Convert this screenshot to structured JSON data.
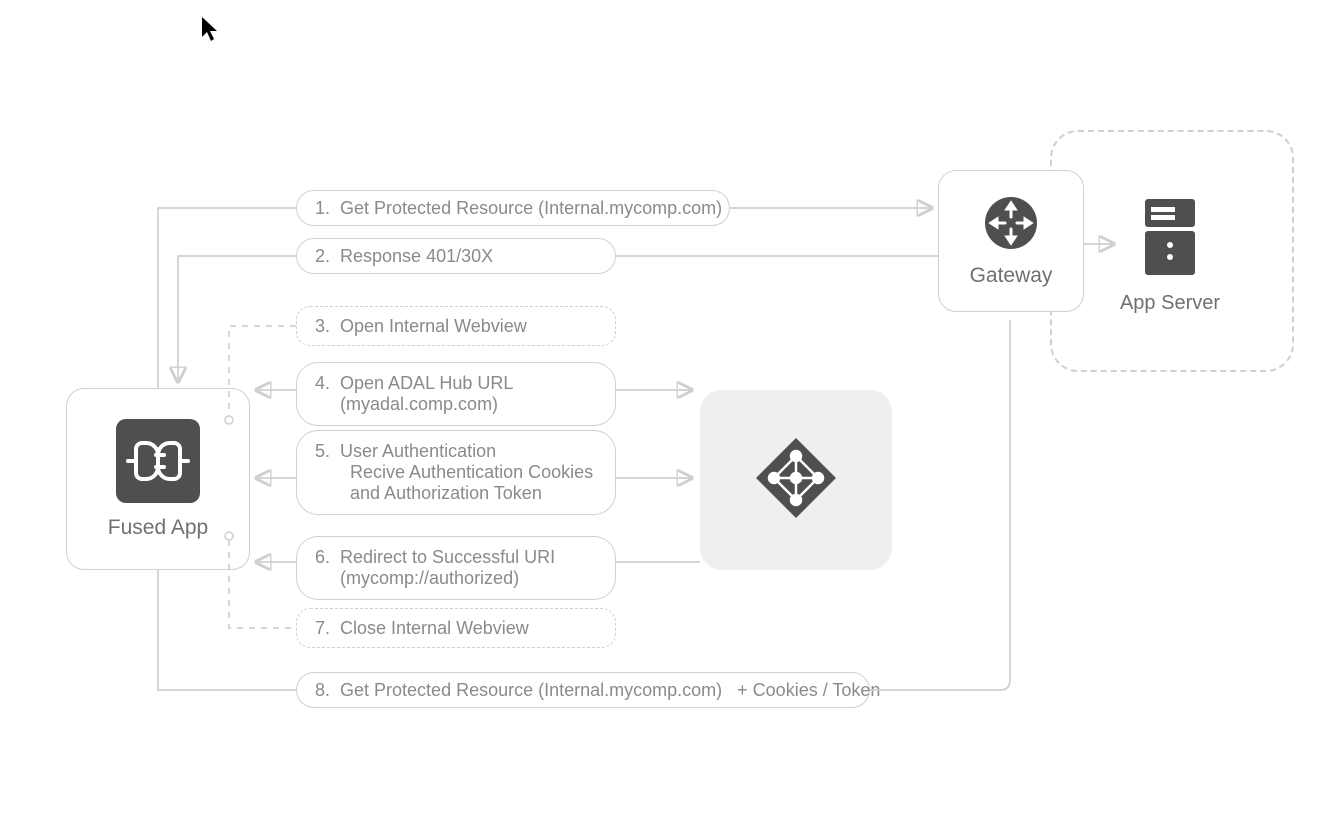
{
  "nodes": {
    "fused_app": {
      "label": "Fused App"
    },
    "gateway": {
      "label": "Gateway"
    },
    "app_server": {
      "label": "App Server"
    },
    "adal": {
      "label": ""
    }
  },
  "steps": {
    "s1": {
      "num": "1.",
      "text": "Get Protected Resource (Internal.mycomp.com)"
    },
    "s2": {
      "num": "2.",
      "text": "Response 401/30X"
    },
    "s3": {
      "num": "3.",
      "text": "Open Internal Webview"
    },
    "s4": {
      "num": "4.",
      "text": "Open ADAL Hub URL\n(myadal.comp.com)"
    },
    "s5": {
      "num": "5.",
      "text": "User Authentication\n  Recive Authentication Cookies\n  and Authorization Token"
    },
    "s6": {
      "num": "6.",
      "text": "Redirect to Successful URI\n(mycomp://authorized)"
    },
    "s7": {
      "num": "7.",
      "text": "Close Internal Webview"
    },
    "s8": {
      "num": "8.",
      "text": "Get Protected Resource (Internal.mycomp.com)   + Cookies / Token"
    }
  },
  "colors": {
    "line": "#cfcfcf",
    "text": "#8a8a8a",
    "icon_bg": "#4f4f4f"
  }
}
